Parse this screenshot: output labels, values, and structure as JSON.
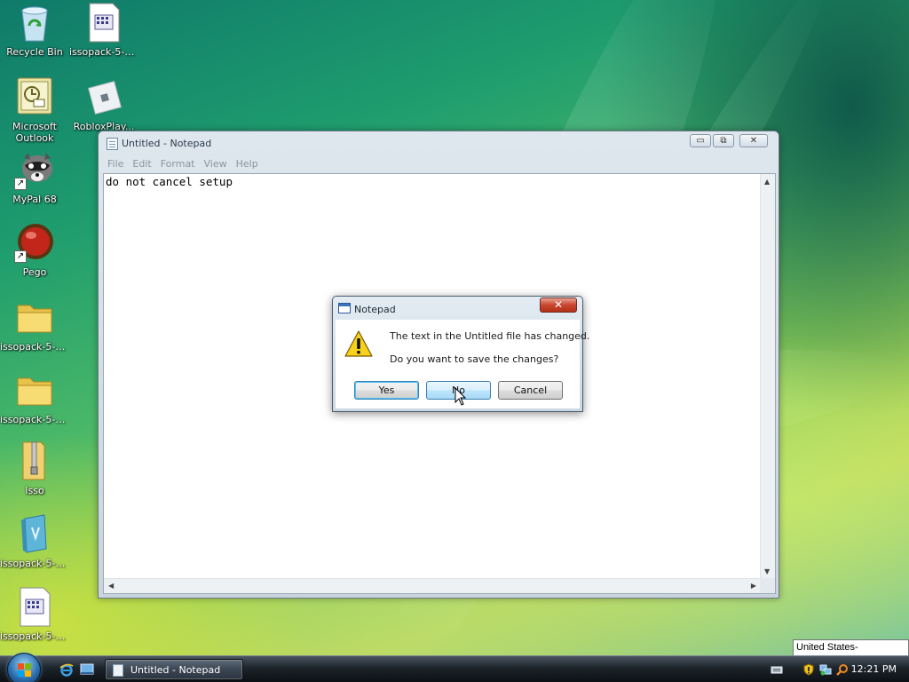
{
  "desktop": {
    "icons": [
      {
        "label": "Recycle Bin"
      },
      {
        "label": "issopack-5-s..."
      },
      {
        "label": "Microsoft Outlook"
      },
      {
        "label": "RobloxPlay..."
      },
      {
        "label": "MyPal 68"
      },
      {
        "label": "Pego"
      },
      {
        "label": "issopack-5-s..."
      },
      {
        "label": "issopack-5-s..."
      },
      {
        "label": "Isso"
      },
      {
        "label": "issopack-5-s..."
      },
      {
        "label": "issopack-5-s..."
      }
    ]
  },
  "notepad": {
    "title": "Untitled - Notepad",
    "menu": [
      "File",
      "Edit",
      "Format",
      "View",
      "Help"
    ],
    "content": "do not cancel setup",
    "controls": {
      "minimize": "▭",
      "maximize": "⧉",
      "close": "✕"
    }
  },
  "dialog": {
    "title": "Notepad",
    "close": "✕",
    "message_line1": "The text in the Untitled file has changed.",
    "message_line2": "Do you want to save the changes?",
    "buttons": {
      "yes": "Yes",
      "no": "No",
      "cancel": "Cancel"
    }
  },
  "taskbar": {
    "active_task": "Untitled - Notepad",
    "clock": "12:21 PM"
  },
  "tooltip": "United States-International",
  "colors": {
    "accent": "#3c7fb1",
    "close_red": "#c9452f"
  }
}
